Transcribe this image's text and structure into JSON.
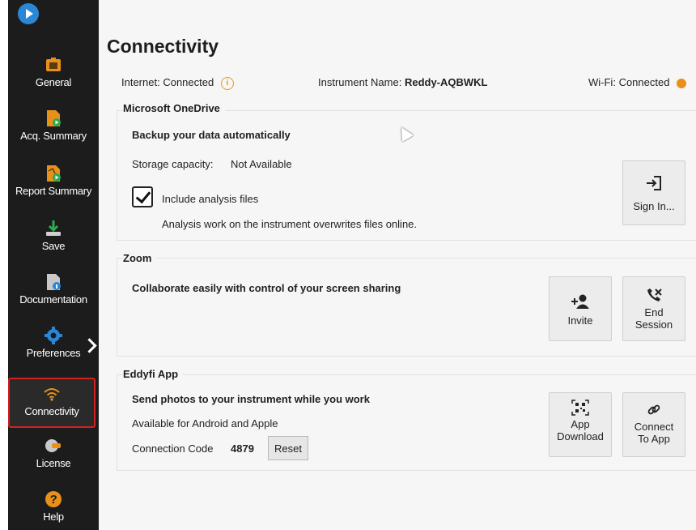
{
  "sidebar": {
    "items": [
      {
        "label": "General",
        "icon": "camera-home-icon"
      },
      {
        "label": "Acq. Summary",
        "icon": "acq-summary-icon"
      },
      {
        "label": "Report Summary",
        "icon": "report-summary-icon"
      },
      {
        "label": "Save",
        "icon": "save-download-icon"
      },
      {
        "label": "Documentation",
        "icon": "documentation-icon"
      },
      {
        "label": "Preferences",
        "icon": "gear-icon"
      },
      {
        "label": "Connectivity",
        "icon": "wifi-icon",
        "active": true
      },
      {
        "label": "License",
        "icon": "license-icon"
      },
      {
        "label": "Help",
        "icon": "help-icon"
      }
    ],
    "accent": "#e8901a",
    "active_border": "#d32020"
  },
  "page": {
    "title": "Connectivity"
  },
  "status": {
    "internet_label": "Internet:",
    "internet_value": "Connected",
    "instrument_label": "Instrument Name:",
    "instrument_value": "Reddy-AQBWKL",
    "wifi_label": "Wi-Fi:",
    "wifi_value": "Connected"
  },
  "onedrive": {
    "title": "Microsoft OneDrive",
    "heading": "Backup your data automatically",
    "storage_label": "Storage capacity:",
    "storage_value": "Not Available",
    "include_label": "Include analysis files",
    "include_checked": true,
    "note": "Analysis work on the instrument overwrites files online.",
    "sign_in_label": "Sign In..."
  },
  "zoom": {
    "title": "Zoom",
    "heading": "Collaborate easily with control of your screen sharing",
    "invite_label": "Invite",
    "end_label_1": "End",
    "end_label_2": "Session"
  },
  "eddyfi": {
    "title": "Eddyfi App",
    "heading": "Send photos to your instrument while you work",
    "availability": "Available for Android and Apple",
    "code_label": "Connection Code",
    "code_value": "4879",
    "reset_label": "Reset",
    "app_download_1": "App",
    "app_download_2": "Download",
    "connect_1": "Connect",
    "connect_2": "To App"
  }
}
